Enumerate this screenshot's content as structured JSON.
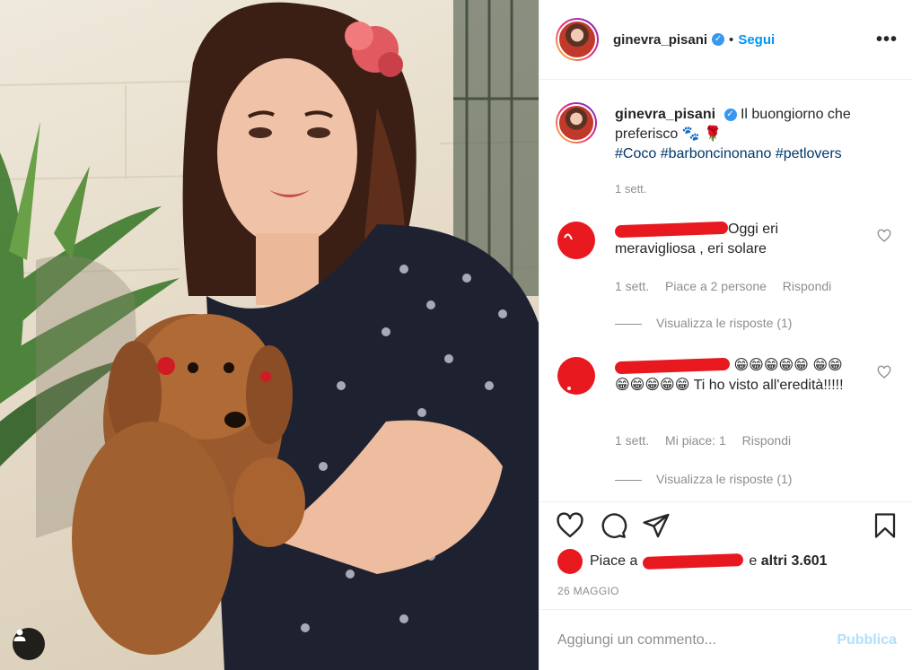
{
  "post": {
    "author": "ginevra_pisani",
    "follow_separator": "•",
    "follow_label": "Segui",
    "more_label": "•••",
    "verified_mark": "✓"
  },
  "caption": {
    "username": "ginevra_pisani",
    "text": "Il buongiorno che preferisco",
    "emojis": "🐾 🌹",
    "hashtags": [
      "#Coco",
      "#barboncinonano",
      "#petlovers"
    ],
    "time": "1 sett."
  },
  "comments": [
    {
      "text_before": "",
      "text": "Oggi eri meravigliosa , eri solare",
      "time": "1 sett.",
      "likes": "Piace a 2 persone",
      "reply": "Rispondi",
      "view_replies": "Visualizza le risposte (1)"
    },
    {
      "emojis_line": "😁😁😁😁😁",
      "emojis_line2": "😁😁😁😁😁😁😁",
      "text": "Ti ho visto all'eredità!!!!!",
      "time": "1 sett.",
      "likes": "Mi piace: 1",
      "reply": "Rispondi",
      "view_replies": "Visualizza le risposte (1)"
    }
  ],
  "likes": {
    "prefix": "Piace a",
    "connector": "e",
    "others": "altri 3.601"
  },
  "date": "26 MAGGIO",
  "add_comment": {
    "placeholder": "Aggiungi un commento...",
    "publish": "Pubblica"
  },
  "icons": {
    "like": "heart-icon",
    "comment": "comment-icon",
    "share": "share-icon",
    "save": "bookmark-icon",
    "user_tag": "user-icon"
  },
  "colors": {
    "accent": "#0095f6",
    "verified": "#3897f0",
    "hashtag": "#00376b",
    "muted": "#8e8e8e",
    "redaction": "#e8181f",
    "publish_disabled": "#b2dffc"
  }
}
